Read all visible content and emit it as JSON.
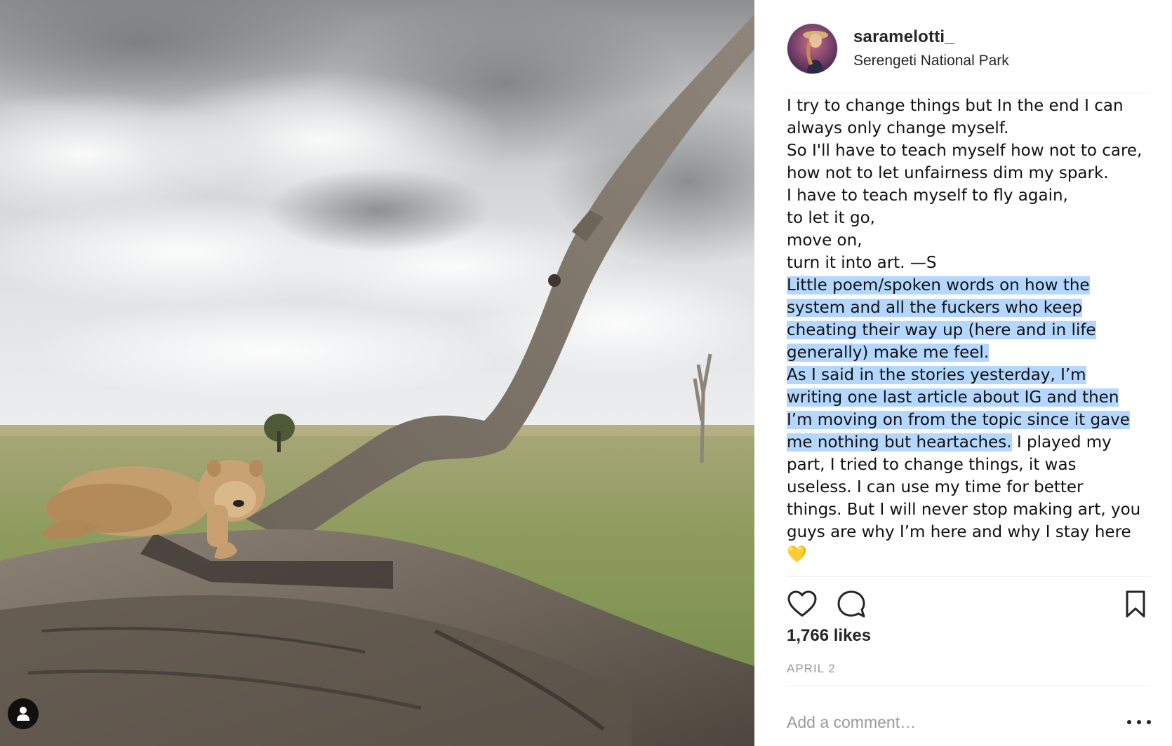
{
  "post": {
    "username": "saramelotti_",
    "location": "Serengeti National Park",
    "caption_lines": [
      {
        "text": "I try to change things but In the end I can",
        "highlighted": false
      },
      {
        "text": "always only change myself.",
        "highlighted": false
      },
      {
        "text": "So I'll have to teach myself how not to care,",
        "highlighted": false
      },
      {
        "text": "how not to let unfairness dim my spark.",
        "highlighted": false
      },
      {
        "text": "I have to teach myself to fly again,",
        "highlighted": false
      },
      {
        "text": "to let it go,",
        "highlighted": false
      },
      {
        "text": "move on,",
        "highlighted": false
      },
      {
        "text": "turn it into art. —S",
        "highlighted": false
      },
      {
        "text": "Little poem/spoken words on how the",
        "highlighted": true
      },
      {
        "text": "system and all the fuckers who keep",
        "highlighted": true
      },
      {
        "text": "cheating their way up (here and in life",
        "highlighted": true
      },
      {
        "text": "generally) make me feel.",
        "highlighted": true
      },
      {
        "text": "As I said in the stories yesterday, I’m",
        "highlighted": true
      },
      {
        "text": "writing one last article about IG and then",
        "highlighted": true
      },
      {
        "text": "I’m moving on from the topic since it gave",
        "highlighted": true
      },
      {
        "text": "me nothing but heartaches.",
        "highlighted": true,
        "rest": " I played my"
      },
      {
        "text": "part, I tried to change things, it was",
        "highlighted": false
      },
      {
        "text": "useless. I can use my time for better",
        "highlighted": false
      },
      {
        "text": "things. But I will never stop making art, you",
        "highlighted": false
      },
      {
        "text": "guys are why I’m here and why I stay here",
        "highlighted": false
      },
      {
        "text": "💛",
        "highlighted": false
      }
    ],
    "likes": "1,766 likes",
    "date": "APRIL 2",
    "comment_placeholder": "Add a comment…",
    "icons": {
      "like": "heart-icon",
      "comment": "comment-bubble-icon",
      "save": "bookmark-icon",
      "more": "more-options-icon",
      "tagged": "user-tag-icon"
    },
    "colors": {
      "selection_highlight": "#b4d7ff",
      "date_text": "#999999",
      "text": "#262626"
    }
  }
}
